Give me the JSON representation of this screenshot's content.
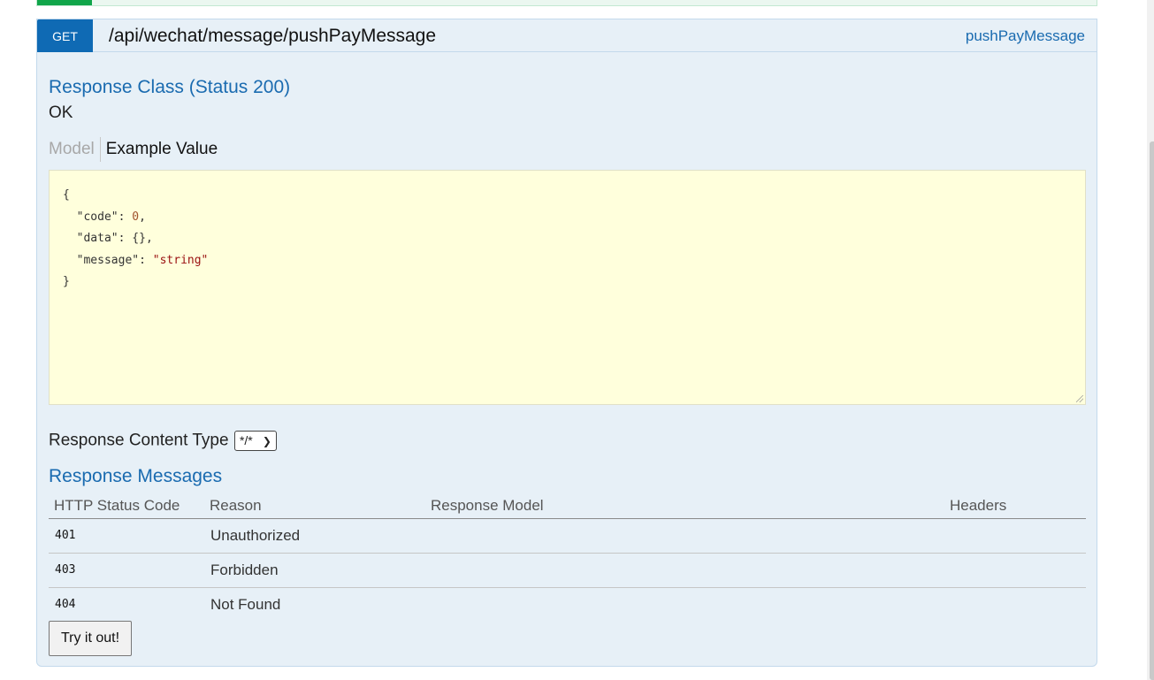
{
  "operation": {
    "method": "GET",
    "path": "/api/wechat/message/pushPayMessage",
    "nickname": "pushPayMessage"
  },
  "response_class": {
    "title": "Response Class (Status 200)",
    "description": "OK"
  },
  "tabs": {
    "model": "Model",
    "example_value": "Example Value"
  },
  "example_value": {
    "lines": [
      {
        "text": "{"
      },
      {
        "key": "\"code\"",
        "sep": ": ",
        "value": "0",
        "kind": "num",
        "trail": ","
      },
      {
        "key": "\"data\"",
        "sep": ": ",
        "value": "{}",
        "kind": "plain",
        "trail": ","
      },
      {
        "key": "\"message\"",
        "sep": ": ",
        "value": "\"string\"",
        "kind": "str",
        "trail": ""
      },
      {
        "text": "}"
      }
    ]
  },
  "response_content_type": {
    "label": "Response Content Type",
    "selected": "*/*"
  },
  "response_messages": {
    "title": "Response Messages",
    "columns": [
      "HTTP Status Code",
      "Reason",
      "Response Model",
      "Headers"
    ],
    "rows": [
      {
        "code": "401",
        "reason": "Unauthorized",
        "model": "",
        "headers": ""
      },
      {
        "code": "403",
        "reason": "Forbidden",
        "model": "",
        "headers": ""
      },
      {
        "code": "404",
        "reason": "Not Found",
        "model": "",
        "headers": ""
      }
    ]
  },
  "try_button_label": "Try it out!",
  "colors": {
    "method_badge": "#0f6ab4",
    "operation_bg": "#e7f0f7",
    "heading_link": "#1a6bb0",
    "example_bg": "#ffffdc",
    "previous_operation_badge": "#10a54a"
  }
}
